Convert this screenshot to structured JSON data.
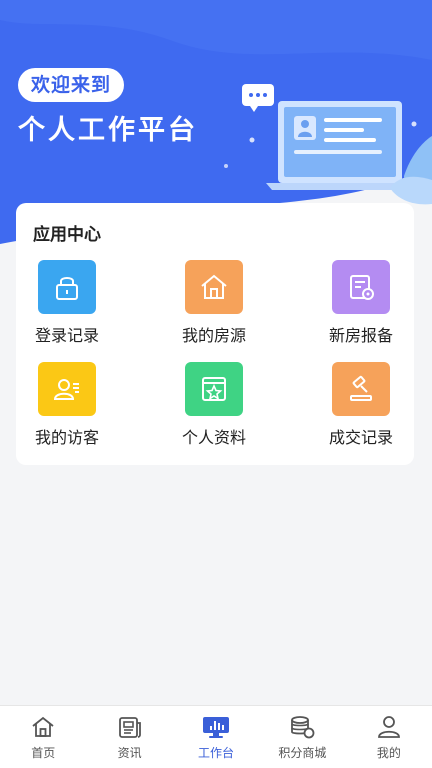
{
  "banner": {
    "welcome": "欢迎来到",
    "title": "个人工作平台"
  },
  "app_center": {
    "title": "应用中心",
    "items": [
      {
        "label": "登录记录",
        "icon": "lock-icon",
        "color": "#3aa6f0"
      },
      {
        "label": "我的房源",
        "icon": "house-icon",
        "color": "#f6a25a"
      },
      {
        "label": "新房报备",
        "icon": "document-gear-icon",
        "color": "#b48cf2"
      },
      {
        "label": "我的访客",
        "icon": "visitor-icon",
        "color": "#fbc815"
      },
      {
        "label": "个人资料",
        "icon": "profile-star-icon",
        "color": "#3fd384"
      },
      {
        "label": "成交记录",
        "icon": "gavel-icon",
        "color": "#f6a25a"
      }
    ]
  },
  "tabbar": {
    "active_color": "#3a5fd8",
    "tabs": [
      {
        "label": "首页",
        "icon": "home-icon"
      },
      {
        "label": "资讯",
        "icon": "news-icon"
      },
      {
        "label": "工作台",
        "icon": "workbench-icon",
        "active": true
      },
      {
        "label": "积分商城",
        "icon": "coins-icon"
      },
      {
        "label": "我的",
        "icon": "user-icon"
      }
    ]
  },
  "colors": {
    "banner_blue": "#3f6af0",
    "page_background": "#f4f5f7"
  }
}
